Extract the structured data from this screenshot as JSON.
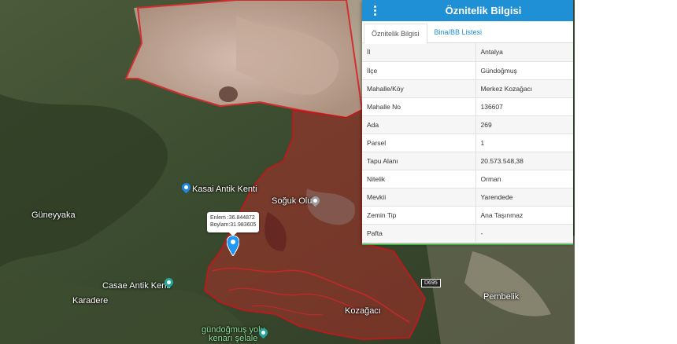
{
  "panel": {
    "title": "Öznitelik Bilgisi",
    "tabs": [
      {
        "label": "Öznitelik Bilgisi",
        "active": true
      },
      {
        "label": "Bina/BB Listesi",
        "active": false
      }
    ],
    "rows": [
      {
        "key": "İl",
        "value": "Antalya"
      },
      {
        "key": "İlçe",
        "value": "Gündoğmuş"
      },
      {
        "key": "Mahalle/Köy",
        "value": "Merkez Kozağacı"
      },
      {
        "key": "Mahalle No",
        "value": "136607"
      },
      {
        "key": "Ada",
        "value": "269"
      },
      {
        "key": "Parsel",
        "value": "1"
      },
      {
        "key": "Tapu Alanı",
        "value": "20.573.548,38"
      },
      {
        "key": "Nitelik",
        "value": "Orman"
      },
      {
        "key": "Mevkii",
        "value": "Yarendede"
      },
      {
        "key": "Zemin Tip",
        "value": "Ana Taşınmaz"
      },
      {
        "key": "Pafta",
        "value": "-"
      }
    ]
  },
  "map": {
    "labels": {
      "kasai": "Kasai Antik Kenti",
      "guneyyaka": "Güneyyaka",
      "soguk_oluk": "Soğuk Oluk",
      "casae": "Casae Antik Kenti",
      "karadere": "Karadere",
      "kozagaci": "Kozağacı",
      "pembelik": "Pembelik",
      "waterfall_line1": "gündoğmuş yolu",
      "waterfall_line2": "kenarı şelale",
      "road_badge": "D695"
    },
    "coord_tip": {
      "line1": "Enlem :36.844872",
      "line2": "Boylam:31.983605"
    }
  },
  "colors": {
    "header": "#1f8fd6",
    "parcel_outline": "#c62828",
    "parcel_fill": "rgba(198,40,40,0.45)"
  }
}
